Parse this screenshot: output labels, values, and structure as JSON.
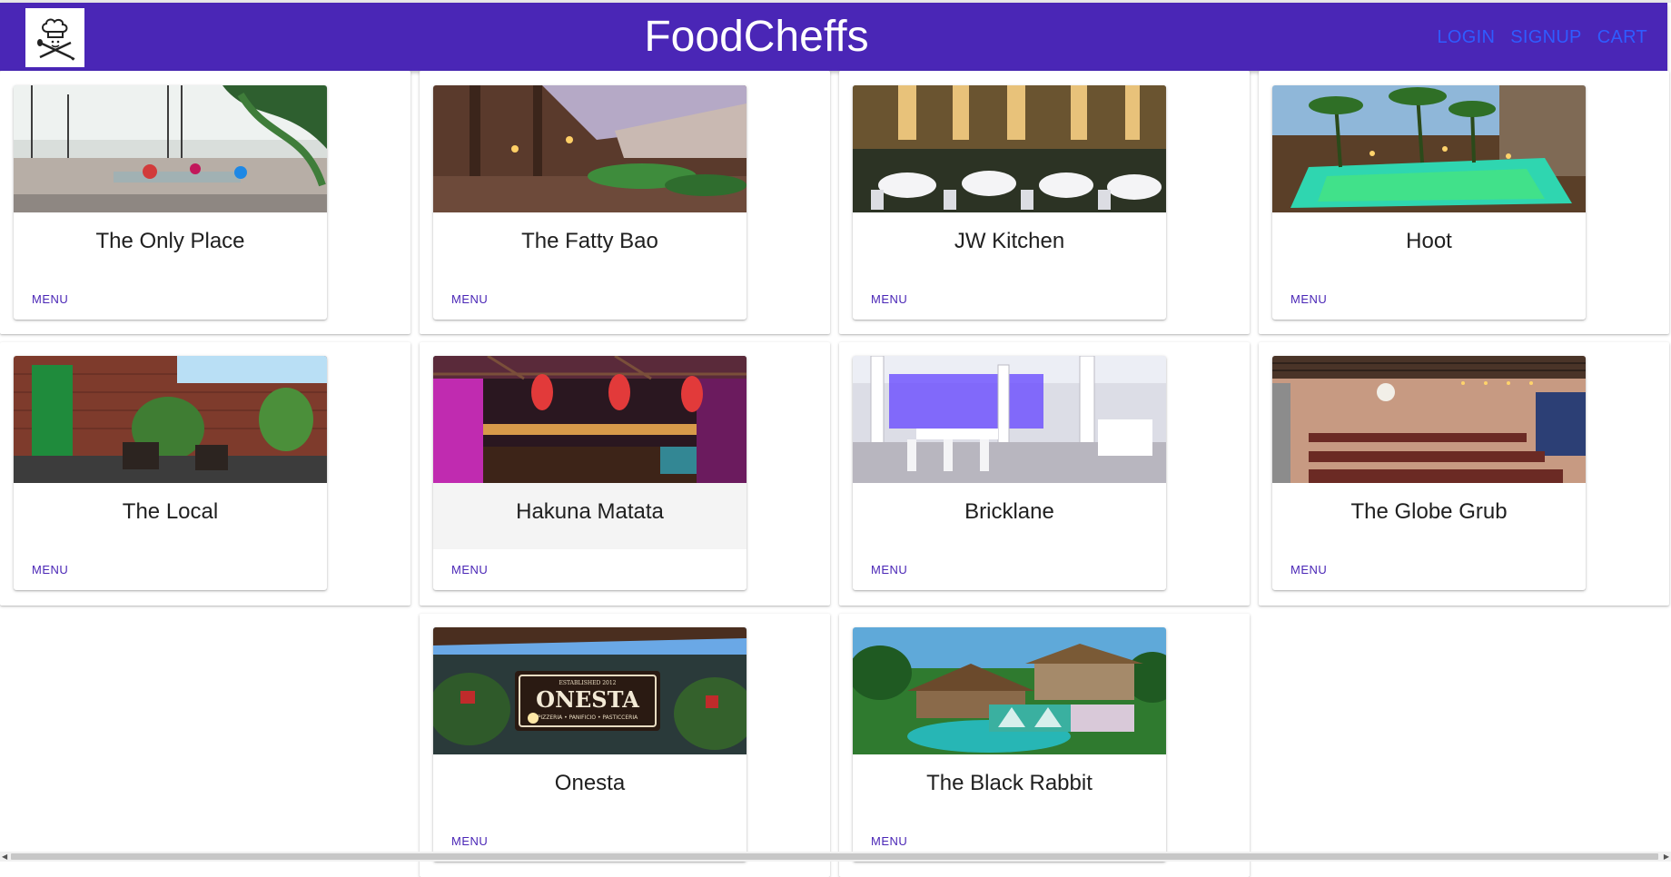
{
  "header": {
    "title": "FoodCheffs",
    "logo_icon": "chef-hat-crossed-utensils-icon",
    "nav": {
      "login": "LOGIN",
      "signup": "SIGNUP",
      "cart": "CART"
    },
    "bar_color": "#4a26b6",
    "link_color": "#2f5cff"
  },
  "restaurants": [
    {
      "name": "The Only Place",
      "menu_label": "MENU"
    },
    {
      "name": "The Fatty Bao",
      "menu_label": "MENU"
    },
    {
      "name": "JW Kitchen",
      "menu_label": "MENU"
    },
    {
      "name": "Hoot",
      "menu_label": "MENU"
    },
    {
      "name": "The Local",
      "menu_label": "MENU"
    },
    {
      "name": "Hakuna Matata",
      "menu_label": "MENU"
    },
    {
      "name": "Bricklane",
      "menu_label": "MENU"
    },
    {
      "name": "The Globe Grub",
      "menu_label": "MENU"
    },
    {
      "name": "Onesta",
      "menu_label": "MENU",
      "sign_text": "ONESTA",
      "sign_subtext": "PIZZERIA • PANIFICIO • PASTICCERIA",
      "sign_est": "ESTABLISHED 2012"
    },
    {
      "name": "The Black Rabbit",
      "menu_label": "MENU"
    }
  ]
}
